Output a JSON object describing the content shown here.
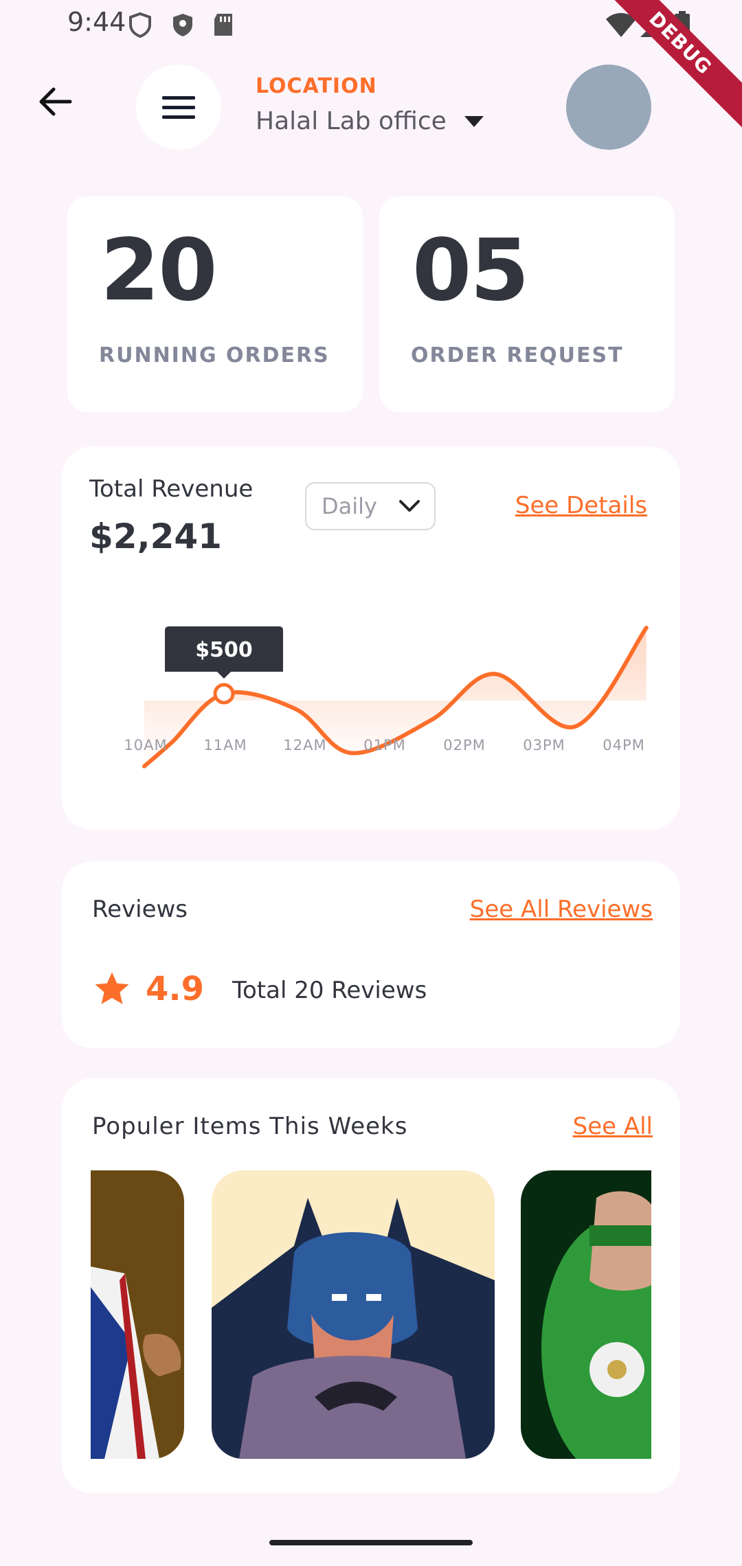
{
  "status": {
    "time": "9:44",
    "debug_label": "DEBUG"
  },
  "header": {
    "location_label": "LOCATION",
    "location_value": "Halal Lab office"
  },
  "stats": [
    {
      "value": "20",
      "label": "RUNNING ORDERS"
    },
    {
      "value": "05",
      "label": "ORDER REQUEST"
    }
  ],
  "revenue": {
    "title": "Total Revenue",
    "amount": "$2,241",
    "period": "Daily",
    "details_link": "See Details",
    "tooltip": "$500"
  },
  "chart_data": {
    "type": "area",
    "categories": [
      "10AM",
      "11AM",
      "12AM",
      "01PM",
      "02PM",
      "03PM",
      "04PM"
    ],
    "x": [
      0,
      0.35,
      1,
      1.9,
      2.6,
      3.6,
      4.4,
      5.4,
      6.3
    ],
    "values": [
      170,
      280,
      500,
      430,
      230,
      380,
      590,
      350,
      800
    ],
    "ylim": [
      0,
      1000
    ],
    "highlight": {
      "x": 1,
      "label": "$500"
    },
    "grid": false,
    "line_color": "#fc6e2a"
  },
  "reviews": {
    "title": "Reviews",
    "see_all": "See All Reviews",
    "rating": "4.9",
    "total": "Total 20 Reviews"
  },
  "popular": {
    "title": "Populer Items This Weeks",
    "see_all": "See All",
    "items": [
      "superhero-item",
      "batman-item",
      "green-lantern-item"
    ]
  },
  "colors": {
    "accent": "#fc6e2a",
    "dark": "#32343e",
    "background": "#fcf4fb"
  }
}
